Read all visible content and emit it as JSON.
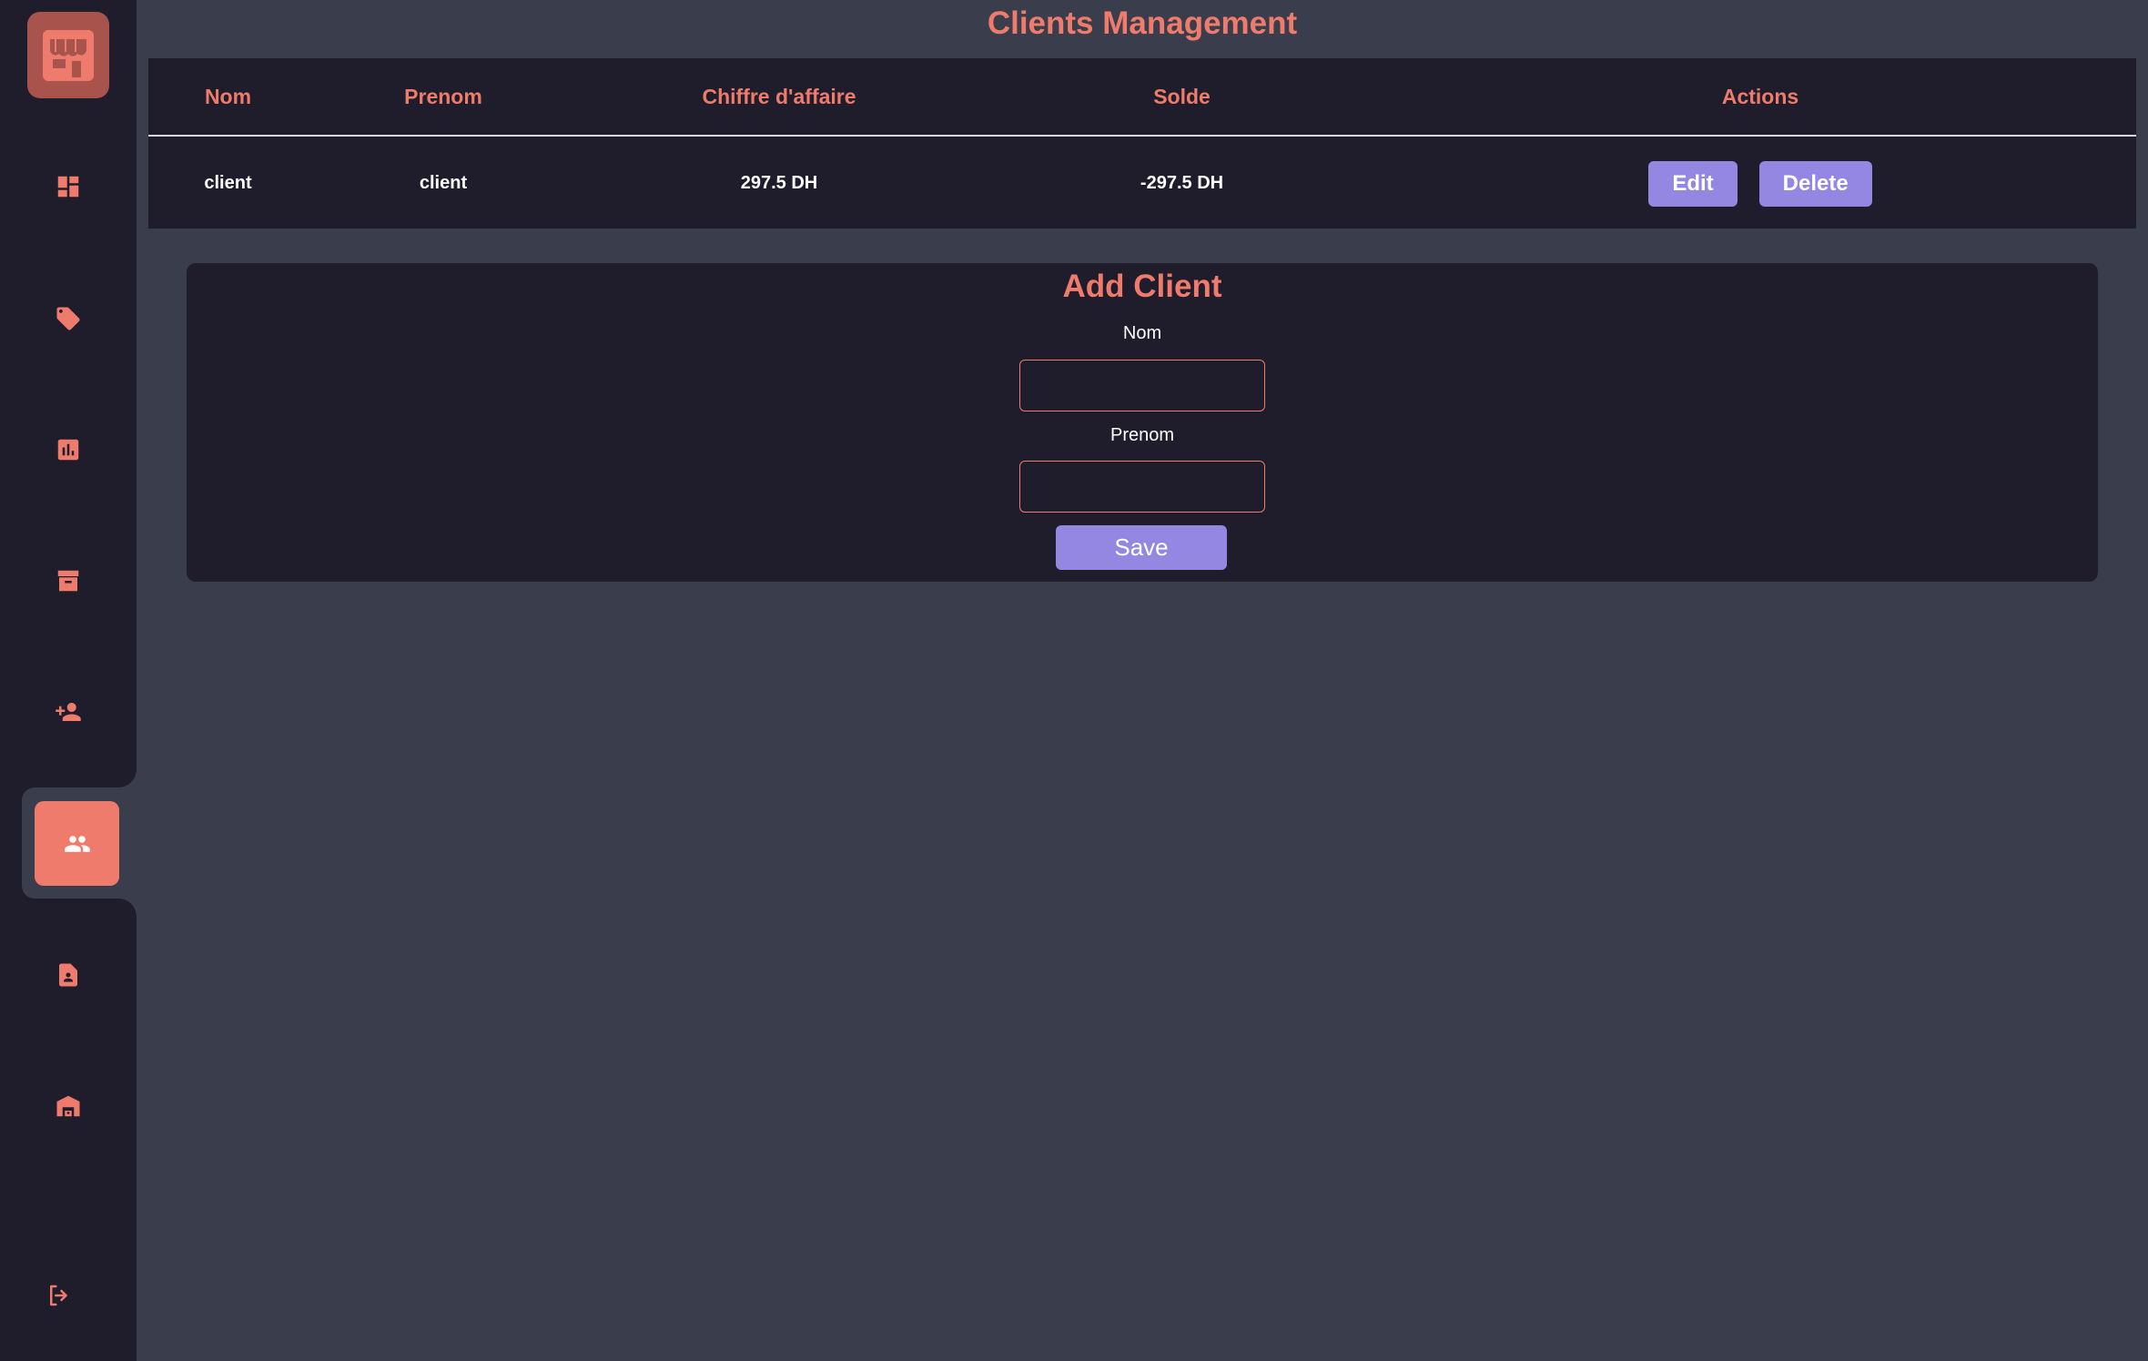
{
  "page": {
    "title": "Clients Management"
  },
  "sidebar": {
    "logo_icon": "store-icon",
    "items": [
      {
        "icon": "dashboard-icon"
      },
      {
        "icon": "tag-icon"
      },
      {
        "icon": "bar-chart-icon"
      },
      {
        "icon": "archive-icon"
      },
      {
        "icon": "add-person-icon"
      },
      {
        "icon": "clients-group-icon",
        "active": true
      },
      {
        "icon": "contact-document-icon"
      },
      {
        "icon": "warehouse-icon"
      }
    ],
    "logout_icon": "logout-icon"
  },
  "table": {
    "headers": [
      "Nom",
      "Prenom",
      "Chiffre d'affaire",
      "Solde",
      "Actions"
    ],
    "rows": [
      {
        "nom": "client",
        "prenom": "client",
        "chiffre": "297.5 DH",
        "solde": "-297.5 DH",
        "edit_label": "Edit",
        "delete_label": "Delete"
      }
    ]
  },
  "form": {
    "title": "Add Client",
    "nom_label": "Nom",
    "nom_value": "",
    "prenom_label": "Prenom",
    "prenom_value": "",
    "save_label": "Save"
  },
  "colors": {
    "accent": "#ee7b6b",
    "button": "#9487e2",
    "panel": "#1f1d2c",
    "background": "#3a3d4b"
  }
}
